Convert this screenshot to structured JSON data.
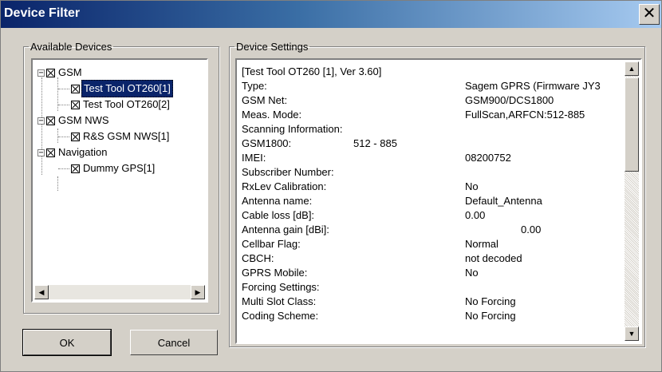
{
  "window": {
    "title": "Device Filter",
    "close_glyph": "✕"
  },
  "devices": {
    "legend": "Available Devices",
    "tree": [
      {
        "label": "GSM",
        "children": [
          {
            "label": "Test Tool OT260[1]",
            "selected": true
          },
          {
            "label": "Test Tool OT260[2]"
          }
        ]
      },
      {
        "label": "GSM NWS",
        "children": [
          {
            "label": "R&S GSM NWS[1]"
          }
        ]
      },
      {
        "label": "Navigation",
        "children": [
          {
            "label": "Dummy GPS[1]"
          }
        ]
      }
    ]
  },
  "settings": {
    "legend": "Device Settings",
    "rows": [
      {
        "label": "[Test Tool OT260 [1], Ver 3.60]",
        "value": ""
      },
      {
        "label": "Type:",
        "value": "Sagem GPRS (Firmware JY3"
      },
      {
        "label": "GSM Net:",
        "value": "GSM900/DCS1800"
      },
      {
        "label": "Meas. Mode:",
        "value": "FullScan,ARFCN:512-885"
      },
      {
        "label": "Scanning Information:",
        "value": ""
      },
      {
        "label": " GSM1800:",
        "value": "512 - 885"
      },
      {
        "label": "IMEI:",
        "value": "08200752"
      },
      {
        "label": "Subscriber Number:",
        "value": ""
      },
      {
        "label": "RxLev Calibration:",
        "value": "No"
      },
      {
        "label": "Antenna name:",
        "value": "Default_Antenna"
      },
      {
        "label": "Cable loss [dB]:",
        "value": "0.00"
      },
      {
        "label": "Antenna gain [dBi]:",
        "value": "0.00"
      },
      {
        "label": "Cellbar Flag:",
        "value": "Normal"
      },
      {
        "label": "CBCH:",
        "value": "not decoded"
      },
      {
        "label": "GPRS Mobile:",
        "value": "No"
      },
      {
        "label": "Forcing Settings:",
        "value": ""
      },
      {
        "label": " Multi Slot Class:",
        "value": "No Forcing"
      },
      {
        "label": " Coding Scheme:",
        "value": "No Forcing"
      }
    ]
  },
  "buttons": {
    "ok": "OK",
    "cancel": "Cancel"
  },
  "icons": {
    "collapse": "−",
    "scroll_left": "◀",
    "scroll_right": "▶",
    "scroll_up": "▲",
    "scroll_down": "▼"
  }
}
